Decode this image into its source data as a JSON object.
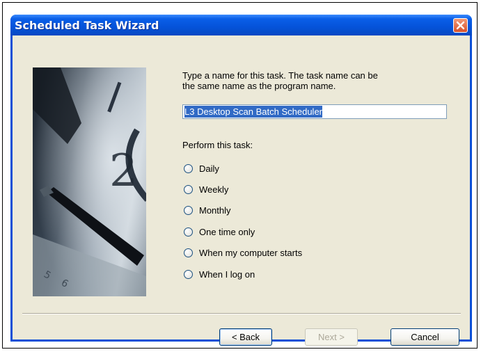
{
  "window": {
    "title": "Scheduled Task Wizard"
  },
  "prompt": {
    "line1": "Type a name for this task.  The task name can be",
    "line2": "the same name as the program name."
  },
  "task_name": {
    "value": "L3 Desktop Scan Batch Scheduler"
  },
  "perform_label": "Perform this task:",
  "options": [
    {
      "label": "Daily"
    },
    {
      "label": "Weekly"
    },
    {
      "label": "Monthly"
    },
    {
      "label": "One time only"
    },
    {
      "label": "When my computer starts"
    },
    {
      "label": "When I log on"
    }
  ],
  "buttons": {
    "back": "< Back",
    "next": "Next >",
    "cancel": "Cancel"
  },
  "colors": {
    "titlebar": "#0553d9",
    "client": "#ece9d8",
    "close": "#d6502a",
    "selection": "#316ac5"
  }
}
